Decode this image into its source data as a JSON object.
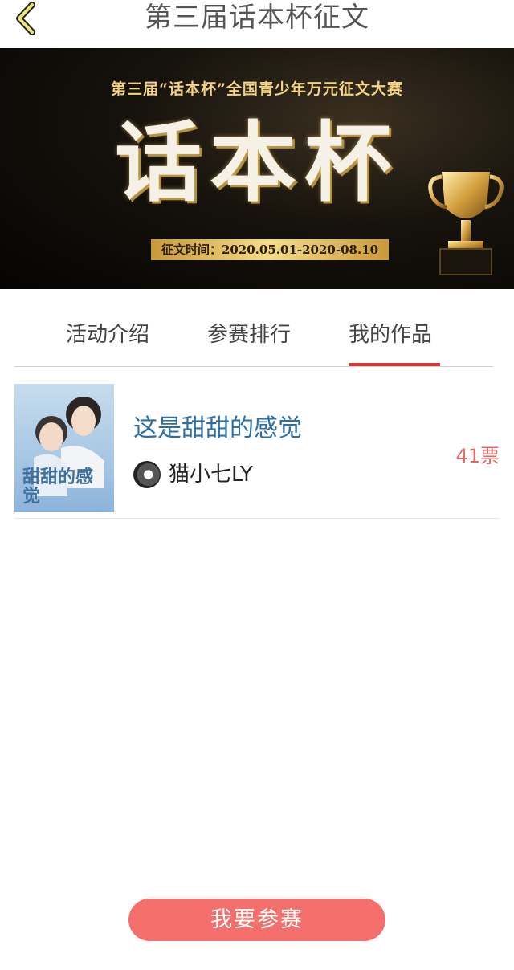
{
  "header": {
    "back_icon": "chevron-left-icon",
    "title": "第三届话本杯征文"
  },
  "banner": {
    "subtitle": "第三届“话本杯”全国青少年万元征文大赛",
    "brand": "话本杯",
    "date_text": "征文时间：2020.05.01-2020-08.10",
    "trophy_icon": "trophy-icon"
  },
  "tabs": [
    {
      "label": "活动介绍",
      "active": false
    },
    {
      "label": "参赛排行",
      "active": false
    },
    {
      "label": "我的作品",
      "active": true
    }
  ],
  "works": [
    {
      "title": "这是甜甜的感觉",
      "cover_text": "甜甜的感觉",
      "author": "猫小七LY",
      "votes": "41票"
    }
  ],
  "join_button": "我要参赛",
  "colors": {
    "accent_red": "#d9383a",
    "button_bg": "#f46f6b",
    "title_blue": "#2a6fa8",
    "votes_red": "#e36a66"
  }
}
